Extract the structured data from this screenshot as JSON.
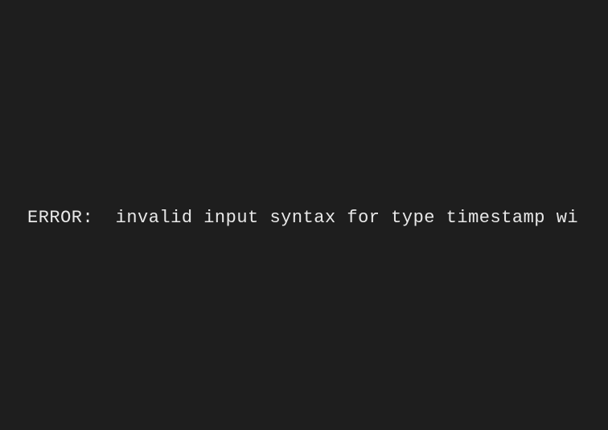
{
  "terminal": {
    "error_line": "ERROR:  invalid input syntax for type timestamp wi"
  }
}
